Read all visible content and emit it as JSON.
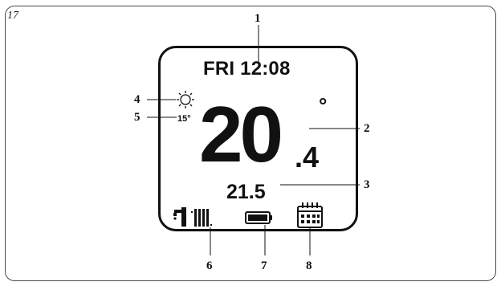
{
  "figure_number": "17",
  "display": {
    "day": "FRI",
    "time": "12:08",
    "temperature_integer": "20",
    "temperature_decimal": ".4",
    "degree_symbol": "°",
    "setpoint": "21.5",
    "outdoor_temperature": "15°"
  },
  "icons": {
    "weather": "sun-icon",
    "hot_water": "tap-icon",
    "heating": "radiator-icon",
    "battery": "battery-icon",
    "program": "calendar-icon"
  },
  "callouts": [
    "1",
    "2",
    "3",
    "4",
    "5",
    "6",
    "7",
    "8"
  ]
}
